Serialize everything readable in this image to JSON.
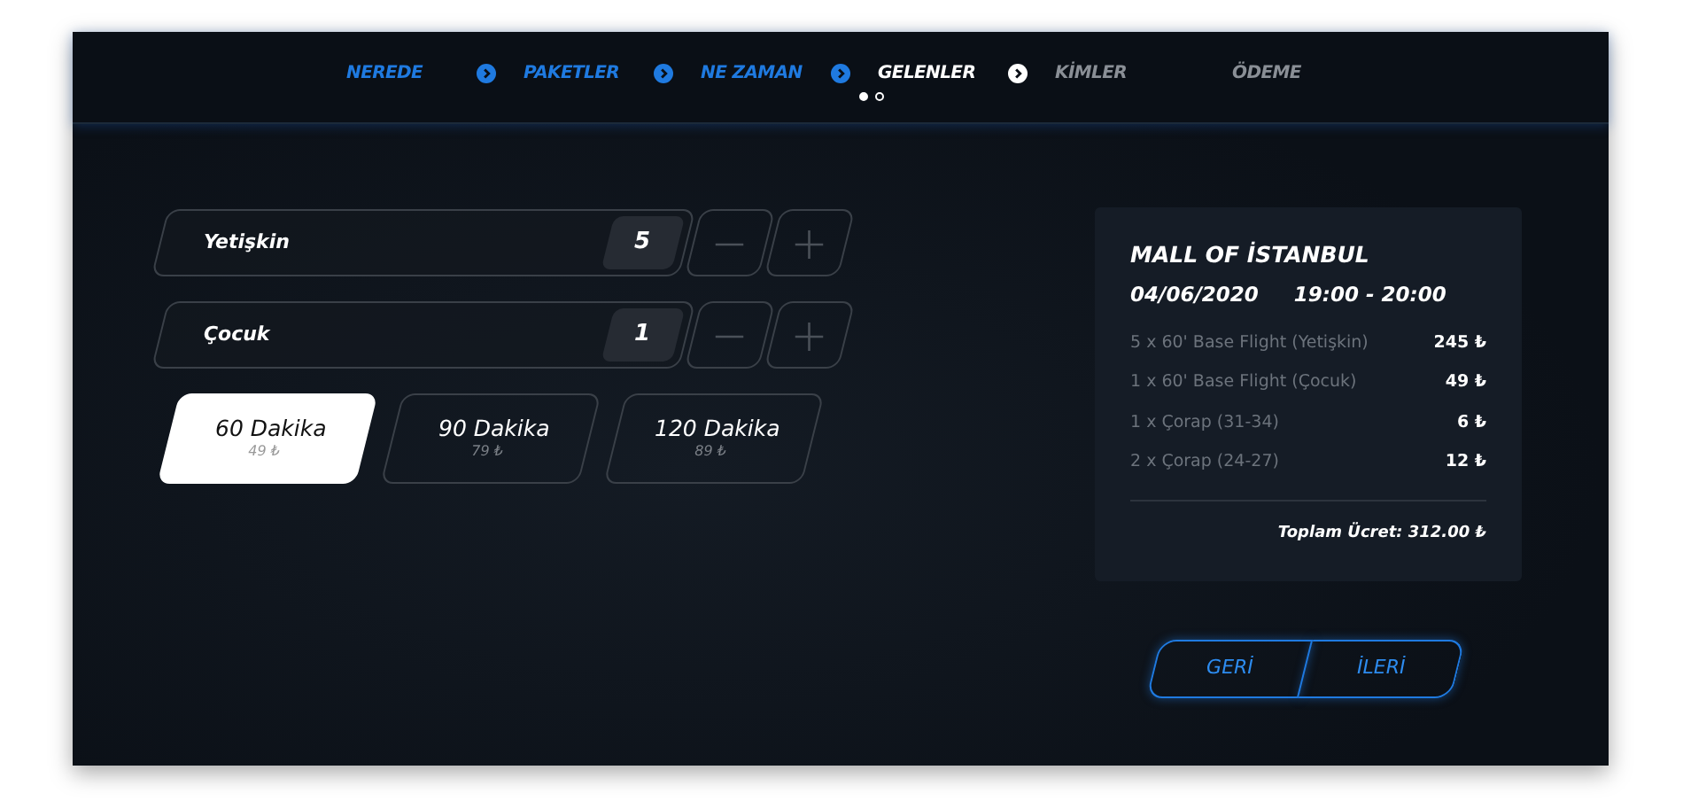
{
  "steps": [
    {
      "label": "NEREDE",
      "completed": true,
      "selected": false,
      "arrow": true
    },
    {
      "label": "PAKETLER",
      "completed": true,
      "selected": false,
      "arrow": true
    },
    {
      "label": "NE ZAMAN",
      "completed": true,
      "selected": false,
      "arrow": true
    },
    {
      "label": "GELENLER",
      "completed": false,
      "selected": true,
      "arrow": true
    },
    {
      "label": "KİMLER",
      "completed": false,
      "selected": false,
      "arrow": false
    },
    {
      "label": "ÖDEME",
      "completed": false,
      "selected": false,
      "arrow": false
    }
  ],
  "pager": [
    {
      "selected": true
    },
    {
      "selected": false
    }
  ],
  "counters": [
    {
      "label": "Yetişkin",
      "value": "5"
    },
    {
      "label": "Çocuk",
      "value": "1"
    }
  ],
  "durations": [
    {
      "label": "60 Dakika",
      "price": "49 ₺",
      "selected": true
    },
    {
      "label": "90 Dakika",
      "price": "79 ₺",
      "selected": false
    },
    {
      "label": "120 Dakika",
      "price": "89 ₺",
      "selected": false
    }
  ],
  "summary": {
    "venue": "MALL OF İSTANBUL",
    "date": "04/06/2020",
    "time": "19:00 - 20:00",
    "lines": [
      {
        "description": "5 x 60' Base Flight (Yetişkin)",
        "amount": "245 ₺"
      },
      {
        "description": "1 x 60' Base Flight (Çocuk)",
        "amount": "49 ₺"
      },
      {
        "description": "1 x Çorap (31-34)",
        "amount": "6 ₺"
      },
      {
        "description": "2 x Çorap (24-27)",
        "amount": "12 ₺"
      }
    ],
    "total": "Toplam Ücret: 312.00 ₺"
  },
  "nav_buttons": [
    "GERİ",
    "İLERİ"
  ]
}
